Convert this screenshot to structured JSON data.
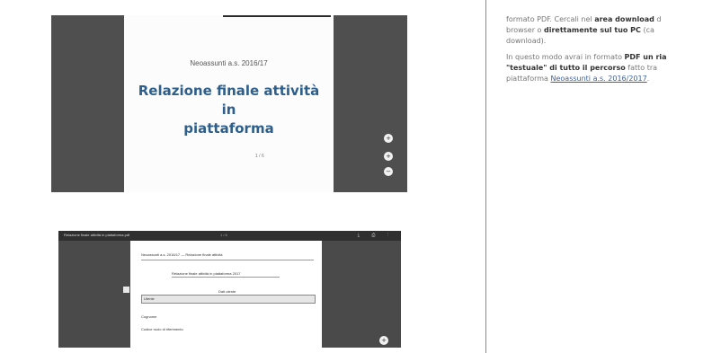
{
  "top_viewer": {
    "slide_subtitle": "Neoassunti a.s. 2016/17",
    "slide_title_line1": "Relazione finale attività in",
    "slide_title_line2": "piattaforma",
    "page_number": "1 / 6",
    "controls": [
      "+",
      "+",
      "−"
    ]
  },
  "bottom_viewer": {
    "toolbar_title": "Relazione finale attività in piattaforma.pdf",
    "toolbar_page": "1 / 6",
    "toolbar_icons": "⤓ ⎙ ⋮",
    "doc_header": "Neoassunti a.s. 2016/17 — Relazione finale attività",
    "doc_heading": "Relazione finale attività in piattaforma 2017",
    "doc_subheading": "Dati utente",
    "doc_field_label": "Utente",
    "doc_line_1": "Cognome",
    "doc_line_2": "Codice ruolo di riferimento",
    "zoom_control": "+"
  },
  "right_panel": {
    "p1_line1_pre": "formato PDF. Cercali nel ",
    "p1_line1_bold": "area download",
    "p1_line1_post": " d",
    "p1_line2_pre": "browser o ",
    "p1_line2_bold": "direttamente sul tuo PC",
    "p1_line2_post": " (ca",
    "p1_line3": "download).",
    "p2_line1_pre": "In questo modo avrai in formato ",
    "p2_line1_bold": "PDF un ria",
    "p2_line2_bold1": "\"testuale\" di tutto il percorso",
    "p2_line2_post": " fatto tra",
    "p2_line3_pre": "piattaforma ",
    "p2_line3_link": "Neoassunti a.s. 2016/2017",
    "p2_line3_post": "."
  }
}
